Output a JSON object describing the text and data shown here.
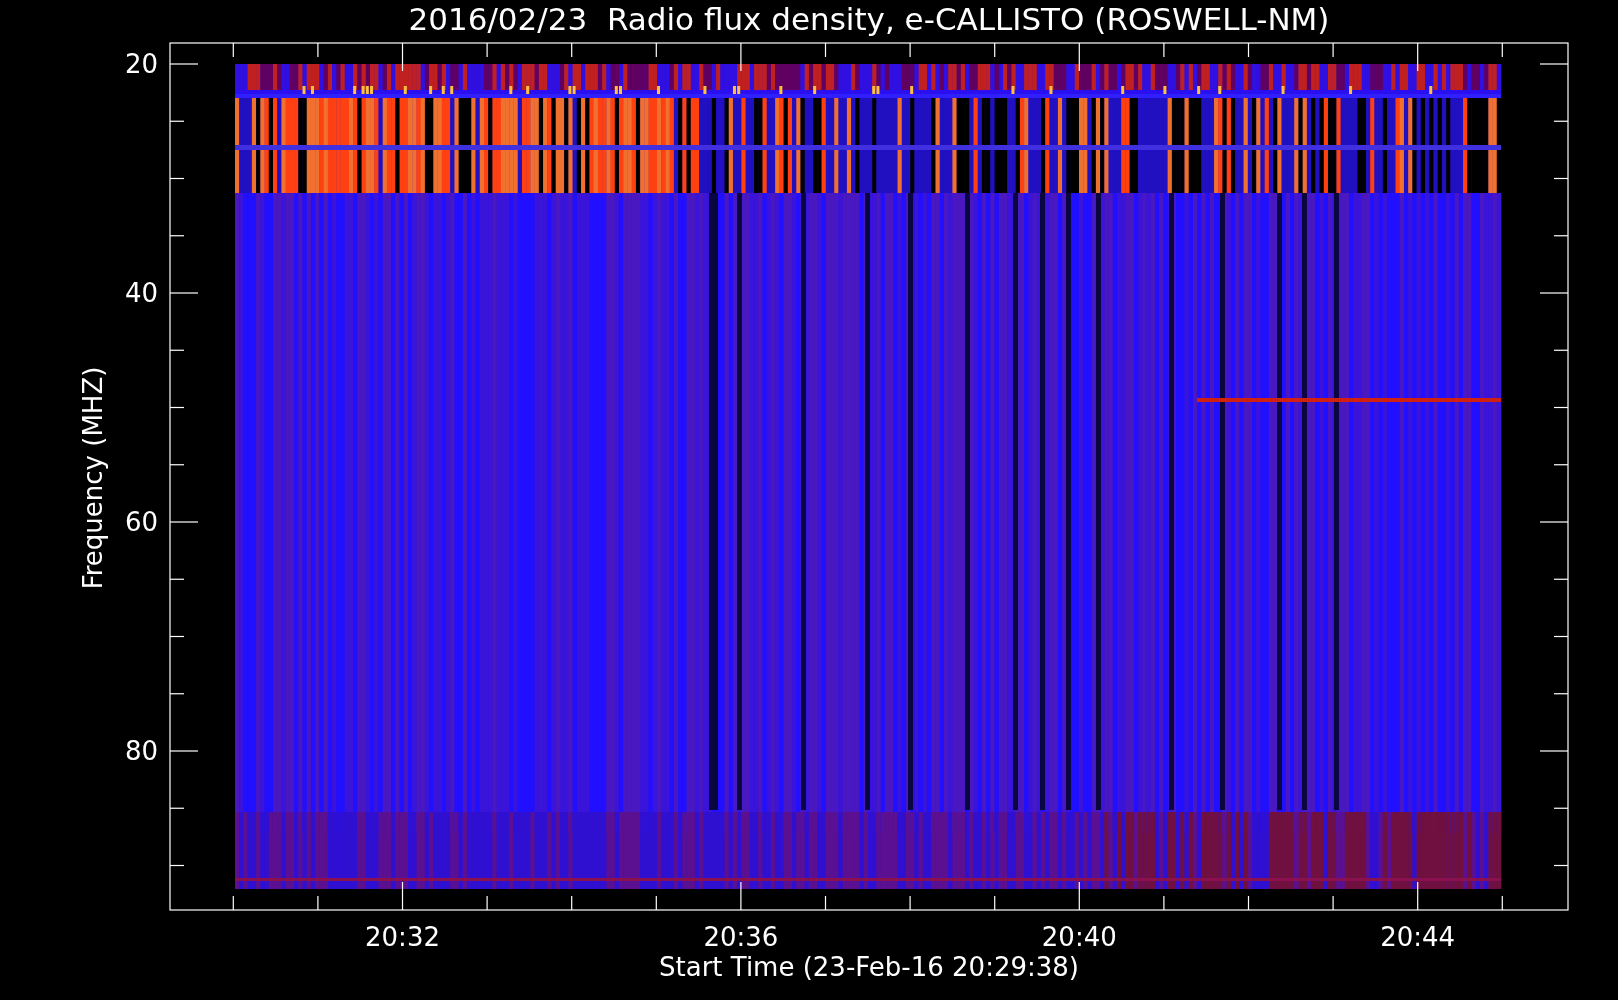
{
  "title": "2016/02/23  Radio flux density, e-CALLISTO (ROSWELL-NM)",
  "y_axis": {
    "label": "Frequency (MHZ)",
    "tick_labels": [
      "20",
      "40",
      "60",
      "80"
    ]
  },
  "x_axis": {
    "label": "Start Time (23-Feb-16 20:29:38)",
    "tick_labels": [
      "20:32",
      "20:36",
      "20:40",
      "20:44"
    ]
  }
}
